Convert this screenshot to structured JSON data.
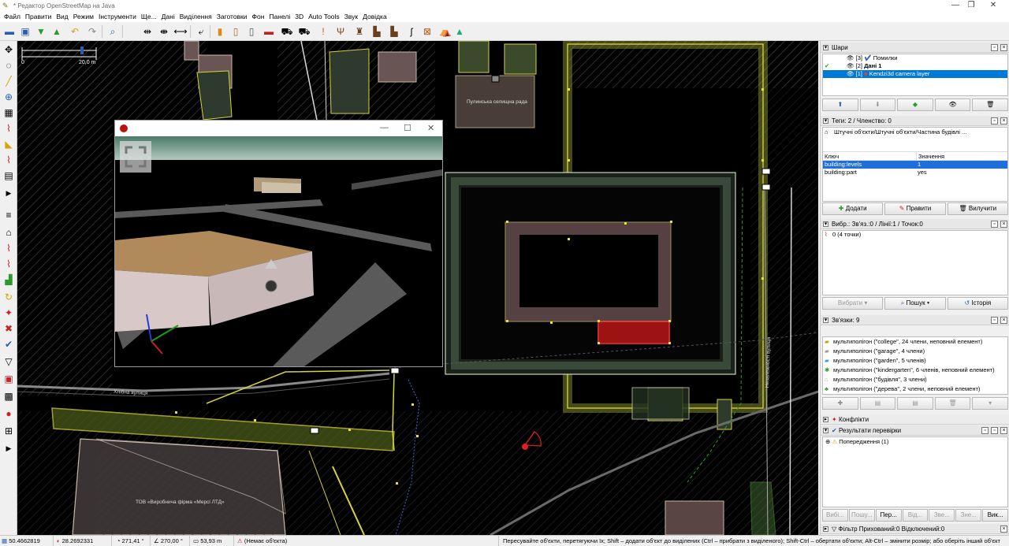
{
  "window": {
    "title": "* Редактор OpenStreetMap на Java",
    "controls": [
      "—",
      "❐",
      "✕"
    ]
  },
  "menu": [
    "Файл",
    "Правити",
    "Вид",
    "Режим",
    "Інструменти",
    "Ще...",
    "Дані",
    "Виділення",
    "Заготовки",
    "Фон",
    "Панелі",
    "3D",
    "Auto Tools",
    "Звук",
    "Довідка"
  ],
  "toolbar_icons": [
    "open-file-icon",
    "save-icon",
    "download-icon",
    "upload-icon",
    "undo-icon",
    "redo-icon",
    "zoom-icon",
    "align-icon",
    "distribute-icon",
    "reverse-icon",
    "split-icon",
    "preset-building-icon",
    "preset-door-icon",
    "preset-entrance-icon",
    "preset-parking-icon",
    "preset-car-icon",
    "preset-car2-icon",
    "warning-icon",
    "restaurant-icon",
    "ruins-icon",
    "factory-icon",
    "factory2-icon",
    "road-icon",
    "mapillary-icon",
    "picnic-icon",
    "mountain-icon"
  ],
  "map": {
    "scale_left": "0",
    "scale_right": "20,0 m",
    "labels": {
      "council": "Пулинська селищна рада",
      "company": "ТОВ «Виробнича фірма «Мерсі ЛТД»",
      "street1": "Хлібна вулиця",
      "street2": "Незалежності вулиця"
    }
  },
  "camera_window": {
    "controls": [
      "—",
      "☐",
      "✕"
    ]
  },
  "layers": {
    "title": "Шари",
    "items": [
      {
        "index": "[3]",
        "name": "Помилки"
      },
      {
        "index": "[2]",
        "name": "Дані 1"
      },
      {
        "index": "[1]",
        "name": "Kendzi3d camera layer"
      }
    ]
  },
  "tags": {
    "title": "Теги: 2 / Членство: 0",
    "preset": "Штучні об'єкти/Штучні об'єкти/Частина будівлі ...",
    "col_key": "Ключ",
    "col_value": "Значення",
    "rows": [
      {
        "key": "building:levels",
        "value": "1"
      },
      {
        "key": "building:part",
        "value": "yes"
      }
    ],
    "buttons": [
      "Додати",
      "Правити",
      "Вилучити"
    ]
  },
  "selection": {
    "title": "Вибр.: Зв'яз.:0 / Лінії:1 / Точок:0",
    "item": "0 (4 точки)",
    "buttons": [
      "Вибрати",
      "Пошук",
      "Історія"
    ]
  },
  "relations": {
    "title": "Зв'язки: 9",
    "items": [
      "мультиполігон (\"college\", 24 члени, неповний елемент)",
      "мультиполігон (\"garage\", 4 члени)",
      "мультиполігон (\"garden\", 5 членів)",
      "мультиполігон (\"kindergarten\", 6 членів, неповний елемент)",
      "мультиполігон (\"будівля\", 3 члени)",
      "мультиполігон (\"дерева\", 2 члени, неповний елемент)"
    ]
  },
  "conflicts": {
    "title": "Конфлікти"
  },
  "validation": {
    "title": "Результати перевірки",
    "item": "Попередження (1)"
  },
  "bottom_tabs": [
    "Вибі...",
    "Пошу...",
    "Пер...",
    "Від...",
    "Зве...",
    "Зне...",
    "Вик..."
  ],
  "filter": {
    "title": "Фільтр Прихований:0 Відключений:0"
  },
  "status": {
    "lat": "50.4662819",
    "lon": "28.2692331",
    "heading": "271,41 °",
    "angle": "270,00 °",
    "distance": "53,93 m",
    "name": "(Немає об'єкта)",
    "help": "Пересувайте об'єкти, перетягуючи їх; Shift – додати об'єкт до виділених (Ctrl – прибрати з виділеного); Shift-Ctrl – обертати об'єкти; Alt-Ctrl – змінити розмір; або оберіть інший об'єкт"
  },
  "colors": {
    "selected_row": "#0078d7",
    "highlight_row": "#1e6fd9",
    "way_yellow": "#d6d43a",
    "selected_red": "#e01818"
  }
}
